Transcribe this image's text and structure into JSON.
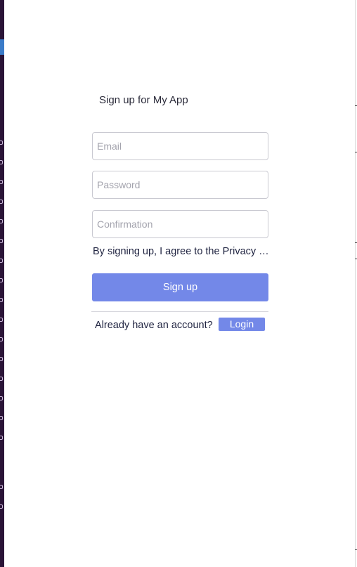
{
  "signup": {
    "title": "Sign up for My App",
    "email_placeholder": "Email",
    "password_placeholder": "Password",
    "confirmation_placeholder": "Confirmation",
    "terms_text": "By signing up, I agree to the Privacy Policy and Terms of Service",
    "signup_label": "Sign up",
    "already_text": "Already have an account?",
    "login_label": "Login"
  },
  "colors": {
    "accent": "#7388e8",
    "left_strip": "#2a1437",
    "text": "#1f2340"
  }
}
